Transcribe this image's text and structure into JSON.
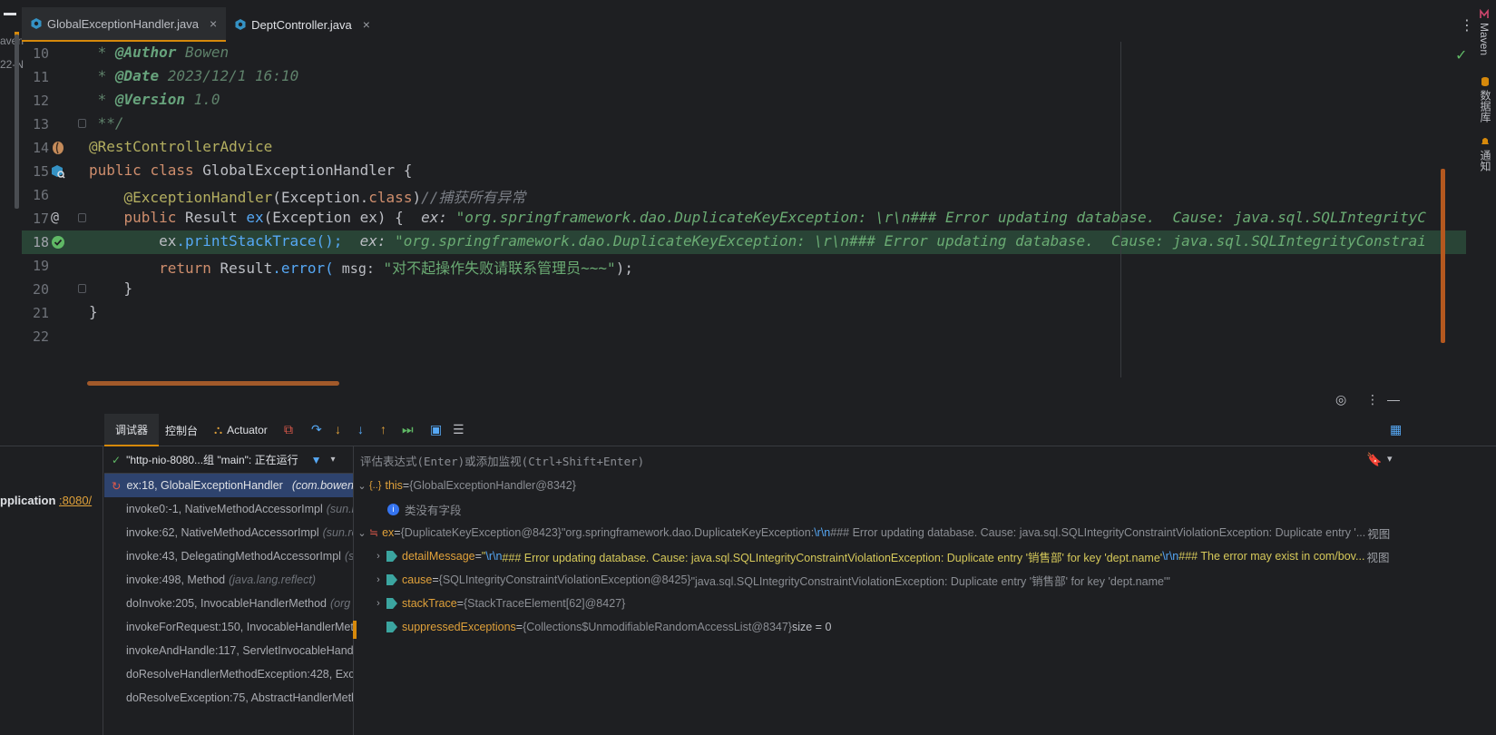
{
  "left_strip": {
    "cut_top": "aven",
    "cut_mid": "22-N"
  },
  "tabs": [
    {
      "label": "GlobalExceptionHandler.java",
      "active": true,
      "close": "×"
    },
    {
      "label": "DeptController.java",
      "active": false,
      "close": "×"
    }
  ],
  "tab_menu": "⋮",
  "right_tools": {
    "maven": "Maven",
    "database": "数据库",
    "notifications": "通知"
  },
  "editor": {
    "lines": [
      {
        "num": "10",
        "doc_star": " * ",
        "tag": "@Author",
        "value": " Bowen"
      },
      {
        "num": "11",
        "doc_star": " * ",
        "tag": "@Date",
        "value": " 2023/12/1 16:10"
      },
      {
        "num": "12",
        "doc_star": " * ",
        "tag": "@Version",
        "value": " 1.0"
      },
      {
        "num": "13",
        "text": " **/"
      },
      {
        "num": "14",
        "annotation": "@RestControllerAdvice"
      },
      {
        "num": "15",
        "kw1": "public",
        "kw2": "class",
        "name": "GlobalExceptionHandler",
        "brace": " {"
      },
      {
        "num": "16",
        "ann": "@ExceptionHandler",
        "p1": "(",
        "arg": "Exception",
        "dot": ".",
        "kw": "class",
        "p2": ")",
        "comment": "//捕获所有异常"
      },
      {
        "num": "17",
        "kw": "public",
        "type": "Result",
        "method": "ex",
        "sig": "(Exception ex) {",
        "hint_name": "ex: ",
        "hint_value": "\"org.springframework.dao.DuplicateKeyException: \\r\\n### Error updating database.  Cause: java.sql.SQLIntegrityC"
      },
      {
        "num": "18",
        "obj": "ex",
        "call": ".printStackTrace();",
        "hint_name": "ex: ",
        "hint_value": "\"org.springframework.dao.DuplicateKeyException: \\r\\n### Error updating database.  Cause: java.sql.SQLIntegrityConstrai"
      },
      {
        "num": "19",
        "kw": "return",
        "cls": "Result",
        "call": ".error(",
        "hint": " msg:",
        "str": " \"对不起操作失败请联系管理员~~~\"",
        "end": ");"
      },
      {
        "num": "20",
        "text": "}"
      },
      {
        "num": "21",
        "text": "}"
      },
      {
        "num": "22",
        "text": ""
      }
    ]
  },
  "debug": {
    "tabs": {
      "debugger": "调试器",
      "console": "控制台",
      "actuator": "Actuator"
    },
    "thread": "\"http-nio-8080...组 \"main\": 正在运行",
    "eval_placeholder": "评估表达式(Enter)或添加监视(Ctrl+Shift+Enter)",
    "services": {
      "app": "pplication",
      "port": ":8080/"
    },
    "frames": [
      {
        "method": "ex:18, GlobalExceptionHandler",
        "pkg": "(com.bowen.e",
        "selected": true
      },
      {
        "method": "invoke0:-1, NativeMethodAccessorImpl",
        "pkg": "(sun.r"
      },
      {
        "method": "invoke:62, NativeMethodAccessorImpl",
        "pkg": "(sun.re"
      },
      {
        "method": "invoke:43, DelegatingMethodAccessorImpl",
        "pkg": "(s"
      },
      {
        "method": "invoke:498, Method",
        "pkg": "(java.lang.reflect)"
      },
      {
        "method": "doInvoke:205, InvocableHandlerMethod",
        "pkg": "(org"
      },
      {
        "method": "invokeForRequest:150, InvocableHandlerMeth",
        "pkg": ""
      },
      {
        "method": "invokeAndHandle:117, ServletInvocableHandl",
        "pkg": ""
      },
      {
        "method": "doResolveHandlerMethodException:428, Exce",
        "pkg": ""
      },
      {
        "method": "doResolveException:75, AbstractHandlerMeth",
        "pkg": ""
      }
    ],
    "variables": {
      "this": {
        "name": "this",
        "eq": " = ",
        "value": "{GlobalExceptionHandler@8342}"
      },
      "no_fields": "类没有字段",
      "ex": {
        "name": "ex",
        "eq": " = ",
        "type": "{DuplicateKeyException@8423}",
        "pre": " \"org.springframework.dao.DuplicateKeyException: ",
        "esc": "\\r\\n",
        "post": "### Error updating database.  Cause: java.sql.SQLIntegrityConstraintViolationException: Duplicate entry '...",
        "view": "视图"
      },
      "detailMessage": {
        "name": "detailMessage",
        "eq": " = ",
        "pre": "\"",
        "esc": "\\r\\n",
        "post": "### Error updating database.  Cause: java.sql.SQLIntegrityConstraintViolationException: Duplicate entry '销售部' for key 'dept.name'",
        "esc2": "\\r\\n",
        "post2": "### The error may exist in com/bov...",
        "view": "视图"
      },
      "cause": {
        "name": "cause",
        "eq": " = ",
        "type": "{SQLIntegrityConstraintViolationException@8425}",
        "value": " \"java.sql.SQLIntegrityConstraintViolationException: Duplicate entry '销售部' for key 'dept.name'\""
      },
      "stackTrace": {
        "name": "stackTrace",
        "eq": " = ",
        "type": "{StackTraceElement[62]@8427}"
      },
      "suppressedExceptions": {
        "name": "suppressedExceptions",
        "eq": " = ",
        "type": "{Collections$UnmodifiableRandomAccessList@8347}",
        "size": "  size = 0"
      }
    }
  }
}
